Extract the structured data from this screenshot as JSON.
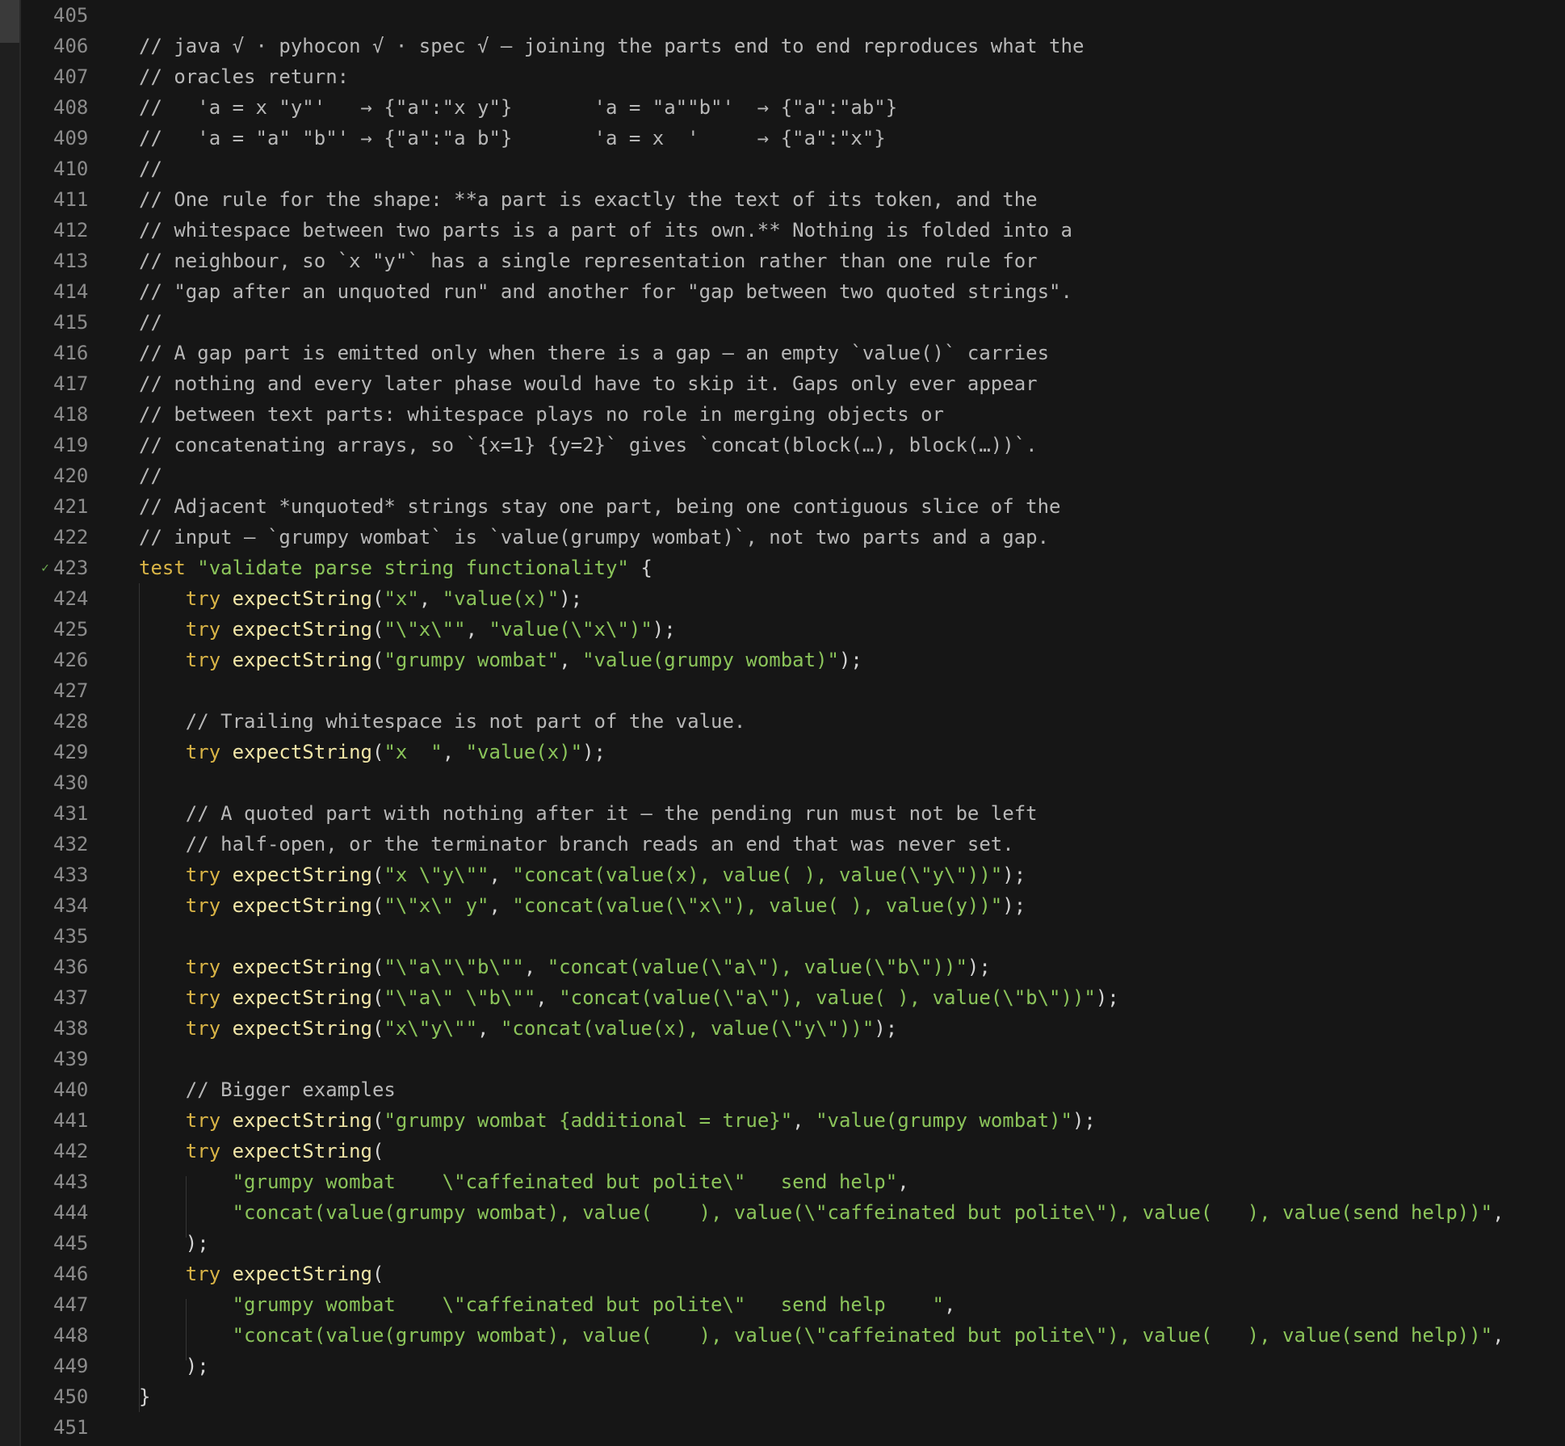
{
  "editor": {
    "lines": [
      {
        "n": "405",
        "mark": "",
        "code": [
          {
            "t": "",
            "c": "p"
          }
        ]
      },
      {
        "n": "406",
        "mark": "",
        "code": [
          {
            "t": "// java √ · pyhocon √ · spec √ — joining the parts end to end reproduces what the",
            "c": "c"
          }
        ]
      },
      {
        "n": "407",
        "mark": "",
        "code": [
          {
            "t": "// oracles return:",
            "c": "c"
          }
        ]
      },
      {
        "n": "408",
        "mark": "",
        "code": [
          {
            "t": "//   'a = x \"y\"'   → {\"a\":\"x y\"}       'a = \"a\"\"b\"'  → {\"a\":\"ab\"}",
            "c": "c"
          }
        ]
      },
      {
        "n": "409",
        "mark": "",
        "code": [
          {
            "t": "//   'a = \"a\" \"b\"' → {\"a\":\"a b\"}       'a = x  '     → {\"a\":\"x\"}",
            "c": "c"
          }
        ]
      },
      {
        "n": "410",
        "mark": "",
        "code": [
          {
            "t": "//",
            "c": "c"
          }
        ]
      },
      {
        "n": "411",
        "mark": "",
        "code": [
          {
            "t": "// One rule for the shape: **a part is exactly the text of its token, and the",
            "c": "c"
          }
        ]
      },
      {
        "n": "412",
        "mark": "",
        "code": [
          {
            "t": "// whitespace between two parts is a part of its own.** Nothing is folded into a",
            "c": "c"
          }
        ]
      },
      {
        "n": "413",
        "mark": "",
        "code": [
          {
            "t": "// neighbour, so `x \"y\"` has a single representation rather than one rule for",
            "c": "c"
          }
        ]
      },
      {
        "n": "414",
        "mark": "",
        "code": [
          {
            "t": "// \"gap after an unquoted run\" and another for \"gap between two quoted strings\".",
            "c": "c"
          }
        ]
      },
      {
        "n": "415",
        "mark": "",
        "code": [
          {
            "t": "//",
            "c": "c"
          }
        ]
      },
      {
        "n": "416",
        "mark": "",
        "code": [
          {
            "t": "// A gap part is emitted only when there is a gap — an empty `value()` carries",
            "c": "c"
          }
        ]
      },
      {
        "n": "417",
        "mark": "",
        "code": [
          {
            "t": "// nothing and every later phase would have to skip it. Gaps only ever appear",
            "c": "c"
          }
        ]
      },
      {
        "n": "418",
        "mark": "",
        "code": [
          {
            "t": "// between text parts: whitespace plays no role in merging objects or",
            "c": "c"
          }
        ]
      },
      {
        "n": "419",
        "mark": "",
        "code": [
          {
            "t": "// concatenating arrays, so `{x=1} {y=2}` gives `concat(block(…), block(…))`.",
            "c": "c"
          }
        ]
      },
      {
        "n": "420",
        "mark": "",
        "code": [
          {
            "t": "//",
            "c": "c"
          }
        ]
      },
      {
        "n": "421",
        "mark": "",
        "code": [
          {
            "t": "// Adjacent *unquoted* strings stay one part, being one contiguous slice of the",
            "c": "c"
          }
        ]
      },
      {
        "n": "422",
        "mark": "",
        "code": [
          {
            "t": "// input — `grumpy wombat` is `value(grumpy wombat)`, not two parts and a gap.",
            "c": "c"
          }
        ]
      },
      {
        "n": "423",
        "mark": "✓",
        "code": [
          {
            "t": "test ",
            "c": "kw"
          },
          {
            "t": "\"validate parse string functionality\"",
            "c": "str"
          },
          {
            "t": " {",
            "c": "p"
          }
        ]
      },
      {
        "n": "424",
        "mark": "",
        "code": [
          {
            "t": "    try ",
            "c": "kw"
          },
          {
            "t": "expectString",
            "c": "fn"
          },
          {
            "t": "(",
            "c": "p"
          },
          {
            "t": "\"x\"",
            "c": "str"
          },
          {
            "t": ", ",
            "c": "p"
          },
          {
            "t": "\"value(x)\"",
            "c": "str"
          },
          {
            "t": ");",
            "c": "p"
          }
        ]
      },
      {
        "n": "425",
        "mark": "",
        "code": [
          {
            "t": "    try ",
            "c": "kw"
          },
          {
            "t": "expectString",
            "c": "fn"
          },
          {
            "t": "(",
            "c": "p"
          },
          {
            "t": "\"\\\"x\\\"\"",
            "c": "str"
          },
          {
            "t": ", ",
            "c": "p"
          },
          {
            "t": "\"value(\\\"x\\\")\"",
            "c": "str"
          },
          {
            "t": ");",
            "c": "p"
          }
        ]
      },
      {
        "n": "426",
        "mark": "",
        "code": [
          {
            "t": "    try ",
            "c": "kw"
          },
          {
            "t": "expectString",
            "c": "fn"
          },
          {
            "t": "(",
            "c": "p"
          },
          {
            "t": "\"grumpy wombat\"",
            "c": "str"
          },
          {
            "t": ", ",
            "c": "p"
          },
          {
            "t": "\"value(grumpy wombat)\"",
            "c": "str"
          },
          {
            "t": ");",
            "c": "p"
          }
        ]
      },
      {
        "n": "427",
        "mark": "",
        "code": [
          {
            "t": "",
            "c": "p"
          }
        ]
      },
      {
        "n": "428",
        "mark": "",
        "code": [
          {
            "t": "    // Trailing whitespace is not part of the value.",
            "c": "c"
          }
        ]
      },
      {
        "n": "429",
        "mark": "",
        "code": [
          {
            "t": "    try ",
            "c": "kw"
          },
          {
            "t": "expectString",
            "c": "fn"
          },
          {
            "t": "(",
            "c": "p"
          },
          {
            "t": "\"x  \"",
            "c": "str"
          },
          {
            "t": ", ",
            "c": "p"
          },
          {
            "t": "\"value(x)\"",
            "c": "str"
          },
          {
            "t": ");",
            "c": "p"
          }
        ]
      },
      {
        "n": "430",
        "mark": "",
        "code": [
          {
            "t": "",
            "c": "p"
          }
        ]
      },
      {
        "n": "431",
        "mark": "",
        "code": [
          {
            "t": "    // A quoted part with nothing after it — the pending run must not be left",
            "c": "c"
          }
        ]
      },
      {
        "n": "432",
        "mark": "",
        "code": [
          {
            "t": "    // half-open, or the terminator branch reads an end that was never set.",
            "c": "c"
          }
        ]
      },
      {
        "n": "433",
        "mark": "",
        "code": [
          {
            "t": "    try ",
            "c": "kw"
          },
          {
            "t": "expectString",
            "c": "fn"
          },
          {
            "t": "(",
            "c": "p"
          },
          {
            "t": "\"x \\\"y\\\"\"",
            "c": "str"
          },
          {
            "t": ", ",
            "c": "p"
          },
          {
            "t": "\"concat(value(x), value( ), value(\\\"y\\\"))\"",
            "c": "str"
          },
          {
            "t": ");",
            "c": "p"
          }
        ]
      },
      {
        "n": "434",
        "mark": "",
        "code": [
          {
            "t": "    try ",
            "c": "kw"
          },
          {
            "t": "expectString",
            "c": "fn"
          },
          {
            "t": "(",
            "c": "p"
          },
          {
            "t": "\"\\\"x\\\" y\"",
            "c": "str"
          },
          {
            "t": ", ",
            "c": "p"
          },
          {
            "t": "\"concat(value(\\\"x\\\"), value( ), value(y))\"",
            "c": "str"
          },
          {
            "t": ");",
            "c": "p"
          }
        ]
      },
      {
        "n": "435",
        "mark": "",
        "code": [
          {
            "t": "",
            "c": "p"
          }
        ]
      },
      {
        "n": "436",
        "mark": "",
        "code": [
          {
            "t": "    try ",
            "c": "kw"
          },
          {
            "t": "expectString",
            "c": "fn"
          },
          {
            "t": "(",
            "c": "p"
          },
          {
            "t": "\"\\\"a\\\"\\\"b\\\"\"",
            "c": "str"
          },
          {
            "t": ", ",
            "c": "p"
          },
          {
            "t": "\"concat(value(\\\"a\\\"), value(\\\"b\\\"))\"",
            "c": "str"
          },
          {
            "t": ");",
            "c": "p"
          }
        ]
      },
      {
        "n": "437",
        "mark": "",
        "code": [
          {
            "t": "    try ",
            "c": "kw"
          },
          {
            "t": "expectString",
            "c": "fn"
          },
          {
            "t": "(",
            "c": "p"
          },
          {
            "t": "\"\\\"a\\\" \\\"b\\\"\"",
            "c": "str"
          },
          {
            "t": ", ",
            "c": "p"
          },
          {
            "t": "\"concat(value(\\\"a\\\"), value( ), value(\\\"b\\\"))\"",
            "c": "str"
          },
          {
            "t": ");",
            "c": "p"
          }
        ]
      },
      {
        "n": "438",
        "mark": "",
        "code": [
          {
            "t": "    try ",
            "c": "kw"
          },
          {
            "t": "expectString",
            "c": "fn"
          },
          {
            "t": "(",
            "c": "p"
          },
          {
            "t": "\"x\\\"y\\\"\"",
            "c": "str"
          },
          {
            "t": ", ",
            "c": "p"
          },
          {
            "t": "\"concat(value(x), value(\\\"y\\\"))\"",
            "c": "str"
          },
          {
            "t": ");",
            "c": "p"
          }
        ]
      },
      {
        "n": "439",
        "mark": "",
        "code": [
          {
            "t": "",
            "c": "p"
          }
        ]
      },
      {
        "n": "440",
        "mark": "",
        "code": [
          {
            "t": "    // Bigger examples",
            "c": "c"
          }
        ]
      },
      {
        "n": "441",
        "mark": "",
        "code": [
          {
            "t": "    try ",
            "c": "kw"
          },
          {
            "t": "expectString",
            "c": "fn"
          },
          {
            "t": "(",
            "c": "p"
          },
          {
            "t": "\"grumpy wombat {additional = true}\"",
            "c": "str"
          },
          {
            "t": ", ",
            "c": "p"
          },
          {
            "t": "\"value(grumpy wombat)\"",
            "c": "str"
          },
          {
            "t": ");",
            "c": "p"
          }
        ]
      },
      {
        "n": "442",
        "mark": "",
        "code": [
          {
            "t": "    try ",
            "c": "kw"
          },
          {
            "t": "expectString",
            "c": "fn"
          },
          {
            "t": "(",
            "c": "p"
          }
        ]
      },
      {
        "n": "443",
        "mark": "",
        "code": [
          {
            "t": "        ",
            "c": "p"
          },
          {
            "t": "\"grumpy wombat    \\\"caffeinated but polite\\\"   send help\"",
            "c": "str"
          },
          {
            "t": ",",
            "c": "p"
          }
        ]
      },
      {
        "n": "444",
        "mark": "",
        "code": [
          {
            "t": "        ",
            "c": "p"
          },
          {
            "t": "\"concat(value(grumpy wombat), value(    ), value(\\\"caffeinated but polite\\\"), value(   ), value(send help))\"",
            "c": "str"
          },
          {
            "t": ",",
            "c": "p"
          }
        ]
      },
      {
        "n": "445",
        "mark": "",
        "code": [
          {
            "t": "    );",
            "c": "p"
          }
        ]
      },
      {
        "n": "446",
        "mark": "",
        "code": [
          {
            "t": "    try ",
            "c": "kw"
          },
          {
            "t": "expectString",
            "c": "fn"
          },
          {
            "t": "(",
            "c": "p"
          }
        ]
      },
      {
        "n": "447",
        "mark": "",
        "code": [
          {
            "t": "        ",
            "c": "p"
          },
          {
            "t": "\"grumpy wombat    \\\"caffeinated but polite\\\"   send help    \"",
            "c": "str"
          },
          {
            "t": ",",
            "c": "p"
          }
        ]
      },
      {
        "n": "448",
        "mark": "",
        "code": [
          {
            "t": "        ",
            "c": "p"
          },
          {
            "t": "\"concat(value(grumpy wombat), value(    ), value(\\\"caffeinated but polite\\\"), value(   ), value(send help))\"",
            "c": "str"
          },
          {
            "t": ",",
            "c": "p"
          }
        ]
      },
      {
        "n": "449",
        "mark": "",
        "code": [
          {
            "t": "    );",
            "c": "p"
          }
        ]
      },
      {
        "n": "450",
        "mark": "",
        "code": [
          {
            "t": "}",
            "c": "p"
          }
        ]
      },
      {
        "n": "451",
        "mark": "",
        "code": [
          {
            "t": "",
            "c": "p"
          }
        ]
      }
    ]
  }
}
